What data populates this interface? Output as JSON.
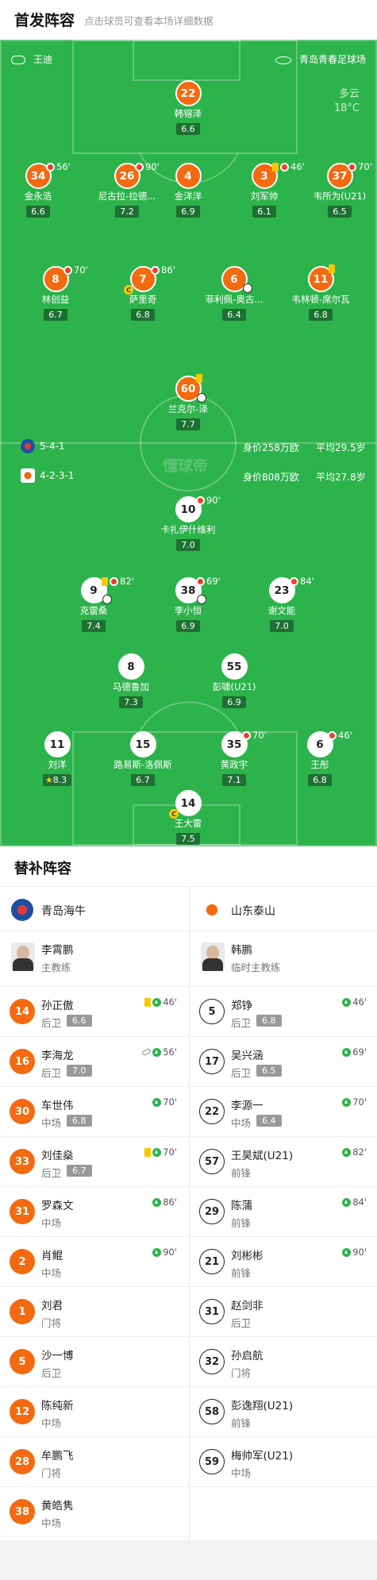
{
  "header": {
    "title": "首发阵容",
    "subtitle": "点击球员可查看本场详细数据"
  },
  "pitch": {
    "referee": "王迪",
    "stadium": "青岛青春足球场",
    "weather": "多云",
    "temperature": "18°C",
    "watermark": "懂球帝",
    "home": {
      "formation": "5-4-1",
      "value": "身价258万欧",
      "age": "平均29.5岁"
    },
    "away": {
      "formation": "4-2-3-1",
      "value": "身价808万欧",
      "age": "平均27.8岁"
    }
  },
  "players": [
    {
      "num": "22",
      "name": "韩镕泽",
      "rating": "6.6",
      "side": "home"
    },
    {
      "num": "34",
      "name": "金永浩",
      "rating": "6.6",
      "side": "home",
      "sub": "56'"
    },
    {
      "num": "26",
      "name": "尼古拉-拉德...",
      "rating": "7.2",
      "side": "home",
      "sub": "90'"
    },
    {
      "num": "4",
      "name": "金洋洋",
      "rating": "6.9",
      "side": "home"
    },
    {
      "num": "3",
      "name": "刘军帅",
      "rating": "6.1",
      "side": "home",
      "sub": "46'",
      "yellow": true
    },
    {
      "num": "37",
      "name": "韦所为(U21)",
      "rating": "6.5",
      "side": "home",
      "sub": "70'"
    },
    {
      "num": "8",
      "name": "林创益",
      "rating": "6.7",
      "side": "home",
      "sub": "70'"
    },
    {
      "num": "7",
      "name": "萨里奇",
      "rating": "6.8",
      "side": "home",
      "sub": "86'",
      "captain": true
    },
    {
      "num": "6",
      "name": "菲利佩-奥古...",
      "rating": "6.4",
      "side": "home",
      "goal": true
    },
    {
      "num": "11",
      "name": "韦林顿-席尔瓦",
      "rating": "6.8",
      "side": "home",
      "yellow": true
    },
    {
      "num": "60",
      "name": "兰克尔-泽",
      "rating": "7.7",
      "side": "home",
      "yellow": true,
      "goal": true
    },
    {
      "num": "10",
      "name": "卡扎伊什维利",
      "rating": "7.0",
      "side": "away",
      "sub": "90'"
    },
    {
      "num": "9",
      "name": "克雷桑",
      "rating": "7.4",
      "side": "away",
      "sub": "82'",
      "yellow": true,
      "goal": true
    },
    {
      "num": "38",
      "name": "李小恒",
      "rating": "6.9",
      "side": "away",
      "sub": "69'",
      "goal": true
    },
    {
      "num": "23",
      "name": "谢文能",
      "rating": "7.0",
      "side": "away",
      "sub": "84'"
    },
    {
      "num": "8",
      "name": "马德鲁加",
      "rating": "7.3",
      "side": "away"
    },
    {
      "num": "55",
      "name": "彭啸(U21)",
      "rating": "6.9",
      "side": "away"
    },
    {
      "num": "11",
      "name": "刘洋",
      "rating": "8.3",
      "side": "away",
      "star": true
    },
    {
      "num": "15",
      "name": "路易斯-洛佩斯",
      "rating": "6.7",
      "side": "away"
    },
    {
      "num": "35",
      "name": "黄政宇",
      "rating": "7.1",
      "side": "away",
      "sub": "70'"
    },
    {
      "num": "6",
      "name": "王彤",
      "rating": "6.8",
      "side": "away",
      "sub": "46'"
    },
    {
      "num": "14",
      "name": "王大雷",
      "rating": "7.5",
      "side": "away",
      "captain": true
    }
  ],
  "subs": {
    "title": "替补阵容",
    "home": {
      "team": "青岛海牛",
      "coach": "李霄鹏",
      "coach_role": "主教练",
      "players": [
        {
          "num": "14",
          "name": "孙正傲",
          "pos": "后卫",
          "rating": "6.6",
          "event": "46'",
          "yellow": true
        },
        {
          "num": "16",
          "name": "李海龙",
          "pos": "后卫",
          "rating": "7.0",
          "event": "56'",
          "assist": true
        },
        {
          "num": "30",
          "name": "车世伟",
          "pos": "中场",
          "rating": "6.8",
          "event": "70'"
        },
        {
          "num": "33",
          "name": "刘佳燊",
          "pos": "后卫",
          "rating": "6.7",
          "event": "70'",
          "yellow": true
        },
        {
          "num": "31",
          "name": "罗森文",
          "pos": "中场",
          "event": "86'"
        },
        {
          "num": "2",
          "name": "肖鲲",
          "pos": "中场",
          "event": "90'"
        },
        {
          "num": "1",
          "name": "刘君",
          "pos": "门将"
        },
        {
          "num": "5",
          "name": "沙一博",
          "pos": "后卫"
        },
        {
          "num": "12",
          "name": "陈纯新",
          "pos": "中场"
        },
        {
          "num": "28",
          "name": "牟鹏飞",
          "pos": "门将"
        },
        {
          "num": "38",
          "name": "黄皓隽",
          "pos": "中场"
        }
      ]
    },
    "away": {
      "team": "山东泰山",
      "coach": "韩鹏",
      "coach_role": "临时主教练",
      "players": [
        {
          "num": "5",
          "name": "郑铮",
          "pos": "后卫",
          "rating": "6.8",
          "event": "46'"
        },
        {
          "num": "17",
          "name": "吴兴涵",
          "pos": "后卫",
          "rating": "6.5",
          "event": "69'"
        },
        {
          "num": "22",
          "name": "李源一",
          "pos": "中场",
          "rating": "6.4",
          "event": "70'"
        },
        {
          "num": "57",
          "name": "王昊斌(U21)",
          "pos": "前锋",
          "event": "82'"
        },
        {
          "num": "29",
          "name": "陈蒲",
          "pos": "前锋",
          "event": "84'"
        },
        {
          "num": "21",
          "name": "刘彬彬",
          "pos": "前锋",
          "event": "90'"
        },
        {
          "num": "31",
          "name": "赵剑非",
          "pos": "后卫"
        },
        {
          "num": "32",
          "name": "孙启航",
          "pos": "门将"
        },
        {
          "num": "58",
          "name": "彭逸翔(U21)",
          "pos": "前锋"
        },
        {
          "num": "59",
          "name": "梅帅军(U21)",
          "pos": "中场"
        }
      ]
    }
  }
}
